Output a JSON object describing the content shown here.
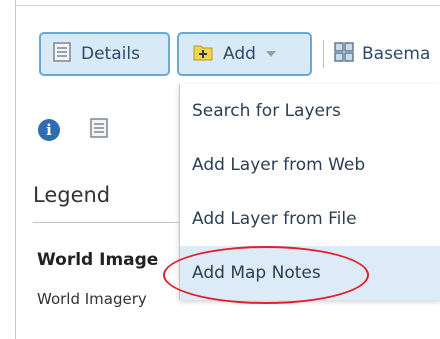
{
  "toolbar": {
    "details_label": "Details",
    "add_label": "Add",
    "basemap_label": "Basema"
  },
  "add_menu": {
    "items": [
      {
        "label": "Search for Layers"
      },
      {
        "label": "Add Layer from Web"
      },
      {
        "label": "Add Layer from File"
      },
      {
        "label": "Add Map Notes",
        "highlighted": true
      }
    ]
  },
  "panel": {
    "legend_title": "Legend",
    "layer_name": "World Image",
    "layer_sublabel": "World Imagery"
  },
  "colors": {
    "button_bg": "#d8eaf8",
    "button_border": "#6aa8d8",
    "highlight_bg": "#dcebf7",
    "annotation": "#e0202a",
    "info_icon": "#2f6db3"
  }
}
